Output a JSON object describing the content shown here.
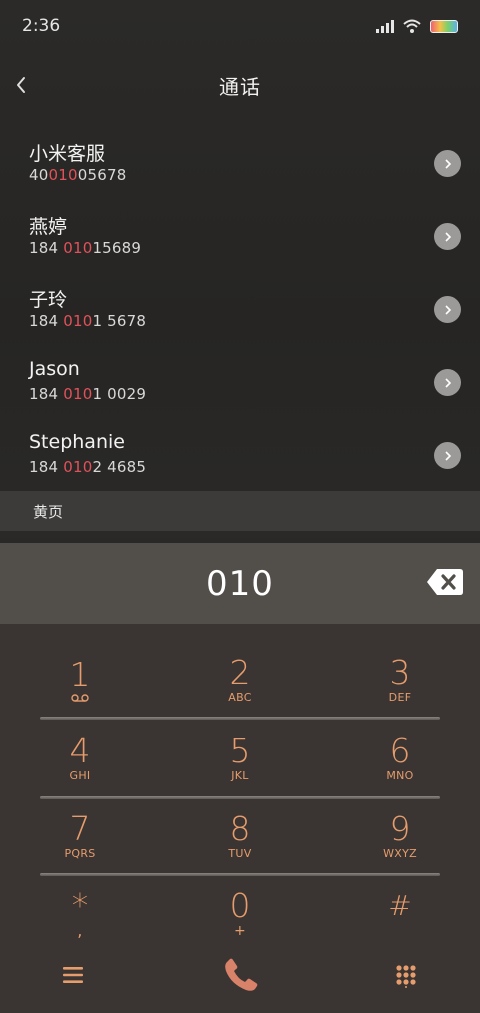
{
  "status": {
    "time": "2:36"
  },
  "header": {
    "title": "通话"
  },
  "contacts": [
    {
      "name": "小米客服",
      "pre": "40",
      "match": "010",
      "post": "05678"
    },
    {
      "name": "燕婷",
      "pre": "184 ",
      "match": "010",
      "post": "15689"
    },
    {
      "name": "子玲",
      "pre": "184 ",
      "match": "010",
      "post": "1 5678"
    },
    {
      "name": "Jason",
      "pre": "184 ",
      "match": "010",
      "post": "1 0029"
    },
    {
      "name": "Stephanie",
      "pre": "184 ",
      "match": "010",
      "post": "2 4685"
    }
  ],
  "section": {
    "yellow_pages": "黄页"
  },
  "dialer": {
    "number": "010"
  },
  "keypad": [
    {
      "digit": "1",
      "letters": ""
    },
    {
      "digit": "2",
      "letters": "ABC"
    },
    {
      "digit": "3",
      "letters": "DEF"
    },
    {
      "digit": "4",
      "letters": "GHI"
    },
    {
      "digit": "5",
      "letters": "JKL"
    },
    {
      "digit": "6",
      "letters": "MNO"
    },
    {
      "digit": "7",
      "letters": "PQRS"
    },
    {
      "digit": "8",
      "letters": "TUV"
    },
    {
      "digit": "9",
      "letters": "WXYZ"
    },
    {
      "digit": "*",
      "letters": ","
    },
    {
      "digit": "0",
      "letters": "+"
    },
    {
      "digit": "#",
      "letters": ""
    }
  ],
  "colors": {
    "accent": "#e69c6c",
    "match_highlight": "#e0525a",
    "call_button": "#d9826a"
  },
  "icons": {
    "voicemail": "voicemail-icon",
    "menu": "menu-icon",
    "call": "phone-icon",
    "dialpad": "dialpad-icon"
  }
}
